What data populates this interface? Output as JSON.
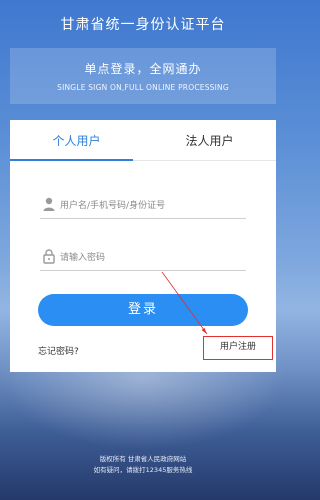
{
  "header": {
    "title": "甘肃省统一身份认证平台"
  },
  "banner": {
    "title": "单点登录，全网通办",
    "subtitle": "SINGLE SIGN ON,FULL ONLINE PROCESSING"
  },
  "tabs": [
    {
      "label": "个人用户",
      "active": true
    },
    {
      "label": "法人用户",
      "active": false
    }
  ],
  "form": {
    "username_placeholder": "用户名/手机号码/身份证号",
    "password_placeholder": "请输入密码",
    "login_label": "登录",
    "forgot_label": "忘记密码?",
    "register_label": "用户注册"
  },
  "footer": {
    "line1": "版权所有    甘肃省人民政府网站",
    "line2": "如有疑问，请拨打12345服务热线"
  },
  "colors": {
    "accent": "#2f7fdb",
    "button": "#2a8ef2",
    "highlight": "#e03030"
  },
  "icons": {
    "user": "user-icon",
    "lock": "lock-icon"
  }
}
